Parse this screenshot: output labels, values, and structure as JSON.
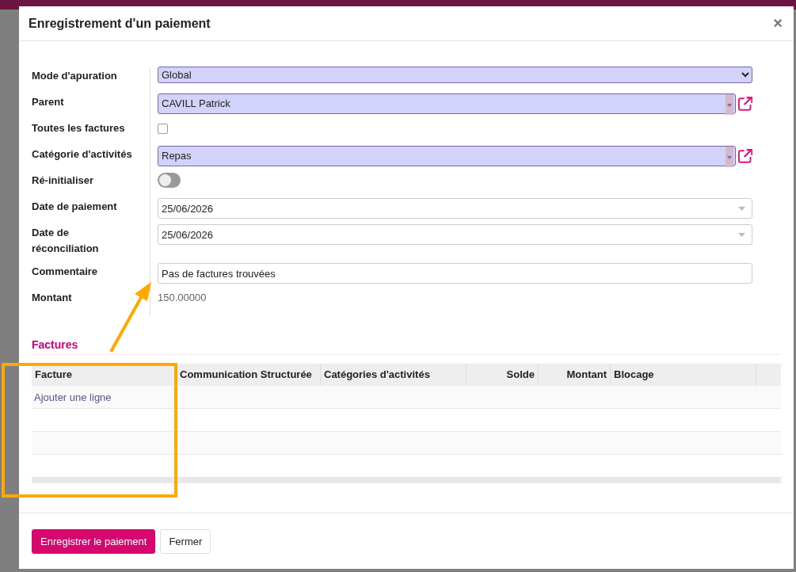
{
  "dialog": {
    "title": "Enregistrement d'un paiement",
    "close": "×"
  },
  "fields": [
    {
      "label": "Mode d'apuration",
      "kind": "select",
      "value": "Global",
      "required": true
    },
    {
      "label": "Parent",
      "kind": "many2one",
      "value": "CAVILL Patrick",
      "required": true
    },
    {
      "label": "Toutes les factures",
      "kind": "checkbox",
      "checked": false
    },
    {
      "label": "Catégorie d'activités",
      "kind": "many2one",
      "value": "Repas",
      "required": true
    },
    {
      "label": "Ré-initialiser",
      "kind": "toggle",
      "on": false
    },
    {
      "label": "Date de paiement",
      "kind": "date",
      "value": "25/06/2026",
      "required": false
    },
    {
      "label": "Date de réconciliation",
      "kind": "date",
      "value": "25/06/2026",
      "required": false
    },
    {
      "label": "Commentaire",
      "kind": "text",
      "value": "Pas de factures trouvées",
      "required": false
    },
    {
      "label": "Montant",
      "kind": "readonly",
      "value": "150.00000"
    }
  ],
  "invoices": {
    "title": "Factures",
    "columns": [
      "Facture",
      "Communication Structurée",
      "Catégories d'activités",
      "Solde",
      "Montant",
      "Blocage"
    ],
    "add_line": "Ajouter une ligne"
  },
  "buttons": [
    {
      "label": "Enregistrer le paiement",
      "kind": "primary"
    },
    {
      "label": "Fermer",
      "kind": "secondary"
    }
  ]
}
